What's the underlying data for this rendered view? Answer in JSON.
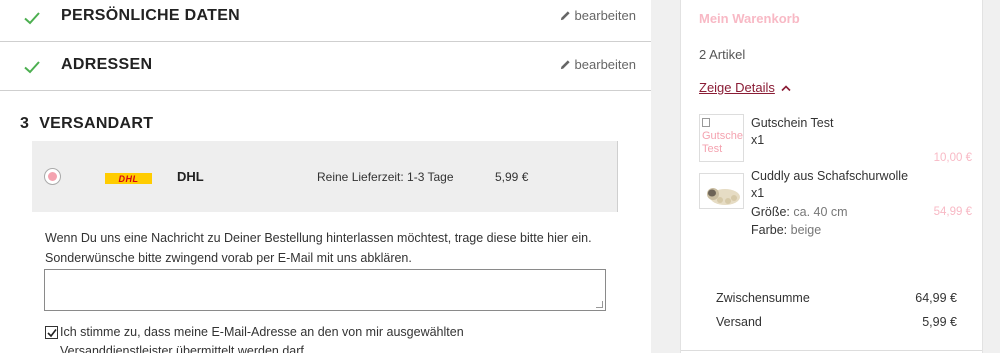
{
  "checkout": {
    "step1": {
      "title": "PERSÖNLICHE DATEN",
      "edit_label": "bearbeiten"
    },
    "step2": {
      "title": "ADRESSEN",
      "edit_label": "bearbeiten"
    },
    "step3": {
      "number": "3",
      "title": "VERSANDART"
    },
    "shipping_option": {
      "carrier": "DHL",
      "logo_text": "DHL",
      "delivery_time": "Reine Lieferzeit: 1-3 Tage",
      "price": "5,99 €",
      "selected": true
    },
    "note_text": "Wenn Du uns eine Nachricht zu Deiner Bestellung hinterlassen möchtest, trage diese bitte hier ein. Sonderwünsche bitte zwingend vorab per E-Mail mit uns abklären.",
    "note_value": "",
    "consent_text": "Ich stimme zu, dass meine E-Mail-Adresse an den von mir ausgewählten Versanddienstleister übermittelt werden darf",
    "consent_checked": true
  },
  "cart": {
    "title": "Mein Warenkorb",
    "count": "2 Artikel",
    "details_label": "Zeige Details",
    "items": [
      {
        "name": "Gutschein Test",
        "qty": "x1",
        "price": "10,00 €",
        "image_alt": "Gutschein Test"
      },
      {
        "name": "Cuddly aus Schafschurwolle",
        "qty": "x1",
        "size_label": "Größe:",
        "size_value": "ca. 40 cm",
        "color_label": "Farbe:",
        "color_value": "beige",
        "price": "54,99 €"
      }
    ],
    "subtotal_label": "Zwischensumme",
    "subtotal_value": "64,99 €",
    "shipping_label": "Versand",
    "shipping_value": "5,99 €"
  },
  "colors": {
    "accent_pink": "#f8b9c5",
    "link_dark_red": "#8a1c35",
    "check_green": "#4caf50"
  }
}
